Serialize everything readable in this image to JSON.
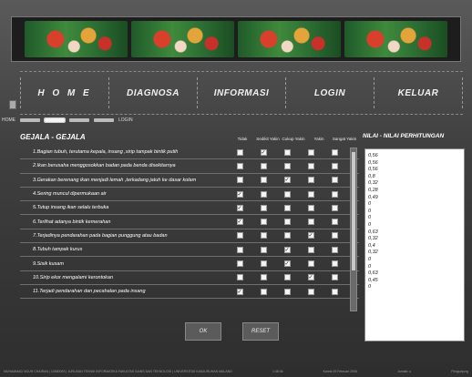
{
  "nav": {
    "items": [
      "H O M E",
      "DIAGNOSA",
      "INFORMASI",
      "LOGIN",
      "KELUAR"
    ]
  },
  "breadcrumb": {
    "home": "HOME",
    "login": "LOGIN"
  },
  "gejala": {
    "title": "GEJALA - GEJALA",
    "columns": [
      "Tidak",
      "Sedikit Yakin",
      "Cukup Yakin",
      "Yakin",
      "Sangat Yakin"
    ],
    "rows": [
      {
        "label": "1.Bagian tubuh, terutama kepala, insang ,sirip tampak bintik putih",
        "checked": 1
      },
      {
        "label": "2.Ikan berusaha menggosokkan badan pada benda disekitarnya",
        "checked": -1
      },
      {
        "label": "3.Gerakan berenang ikan menjadi lemah ,terkadang jatuh ke dasar kolam",
        "checked": 2
      },
      {
        "label": "4.Sering muncul dipermukaan air",
        "checked": 0
      },
      {
        "label": "5.Tutup insang ikan selalu terbuka",
        "checked": 0
      },
      {
        "label": "6.Terlihat  adanya bintik kemerahan",
        "checked": 0
      },
      {
        "label": "7.Terjadinya pendarahan pada bagian punggung atau badan",
        "checked": 3
      },
      {
        "label": "8.Tubuh tampak kurus",
        "checked": 2
      },
      {
        "label": "9.Sisik kusam",
        "checked": 2
      },
      {
        "label": "10.Sirip ekor mengalami kerontokan",
        "checked": 3
      },
      {
        "label": "11.Terjadi pendarahan dan pecahalan pada insang",
        "checked": 0
      }
    ]
  },
  "buttons": {
    "ok": "OK",
    "reset": "RESET"
  },
  "nilai": {
    "title": "NILAI - NILAI PERHITUNGAN",
    "values": [
      "0,56",
      "0,56",
      "0,56",
      "0,8",
      "0,32",
      "0,28",
      "0,49",
      "0",
      "0",
      "0",
      "0",
      "0,63",
      "0,32",
      "0,4",
      "0,32",
      "0",
      "0",
      "0,63",
      "0,45",
      "0"
    ]
  },
  "footer": {
    "left": "MUHAMMAD NOUR CHAIRAN | 10580093 | JURUSAN TEKNIK INFORMATIKA FAKULTAS SAINS DAN TEKNOLOGI | UNIVERSITAS KANJURUHAN MALANG",
    "time": "1:48:46",
    "date": "Kamis 09 Februari 2006",
    "jumlah": "Jumlah: u",
    "pengunjung": "Pengunjung"
  }
}
